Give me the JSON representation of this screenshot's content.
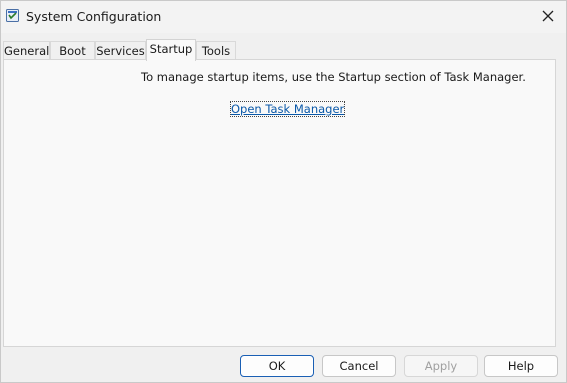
{
  "window": {
    "title": "System Configuration",
    "app_icon": "msconfig-icon",
    "close_icon": "close-icon"
  },
  "tabs": [
    {
      "label": "General",
      "active": false
    },
    {
      "label": "Boot",
      "active": false
    },
    {
      "label": "Services",
      "active": false
    },
    {
      "label": "Startup",
      "active": true
    },
    {
      "label": "Tools",
      "active": false
    }
  ],
  "startup": {
    "message": "To manage startup items, use the Startup section of Task Manager.",
    "link_label": "Open Task Manager"
  },
  "buttons": {
    "ok": "OK",
    "cancel": "Cancel",
    "apply": "Apply",
    "help": "Help"
  },
  "colors": {
    "link": "#0a58a8",
    "default_button_border": "#1a5fb4",
    "disabled_text": "#a0a0a0"
  }
}
